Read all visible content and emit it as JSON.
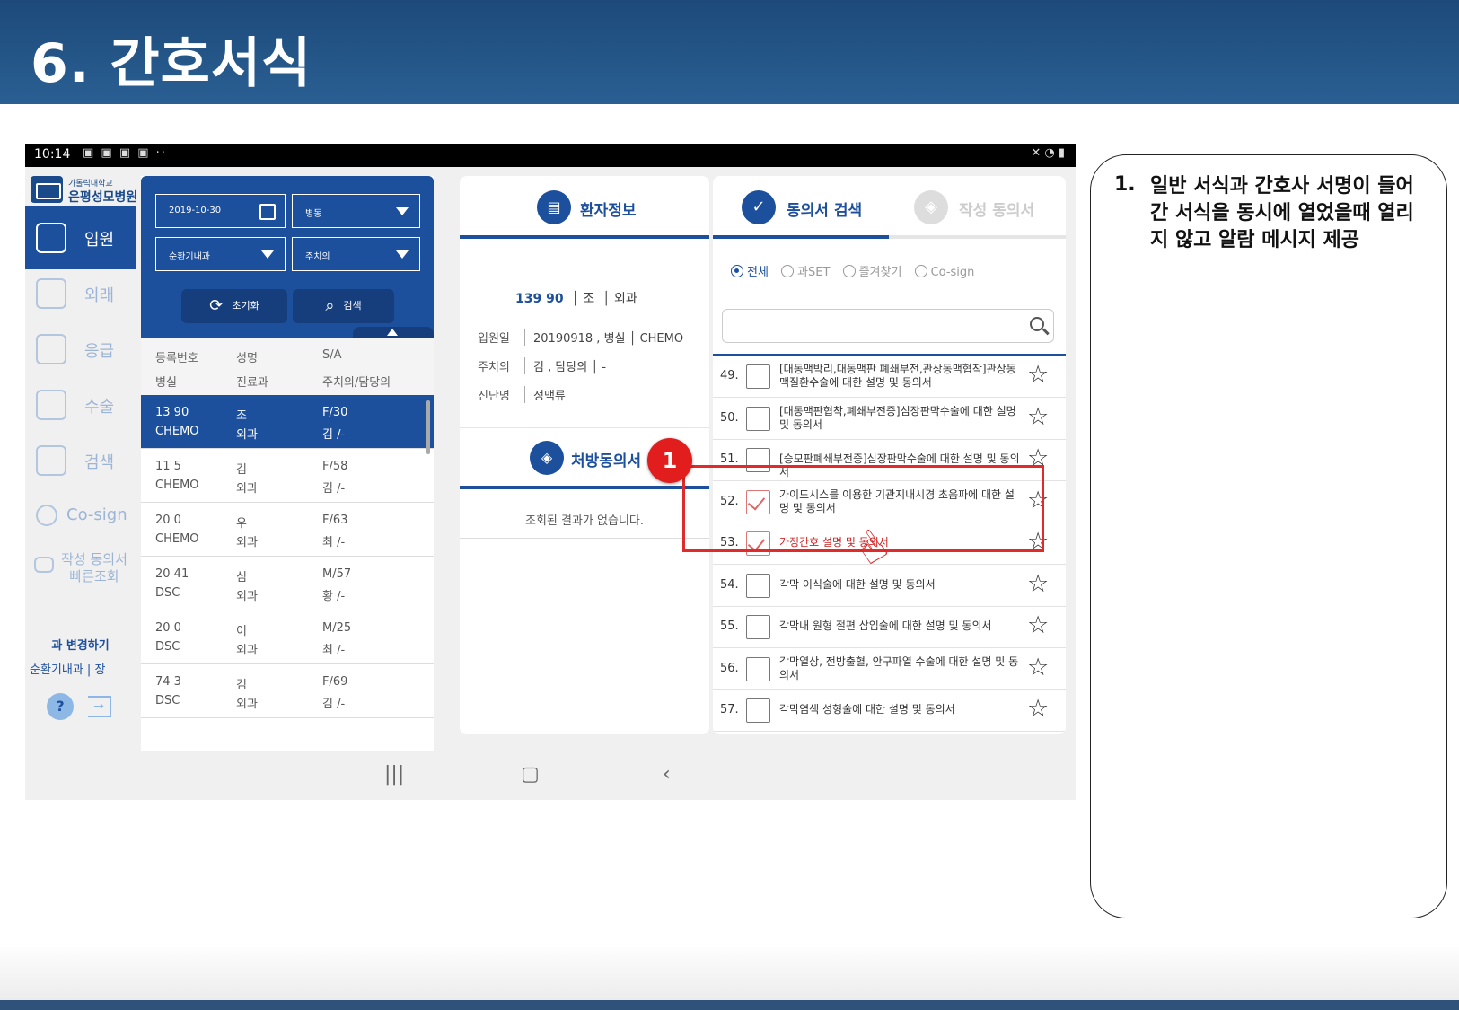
{
  "slide": {
    "title": "6. 간호서식",
    "callout": {
      "number": "1.",
      "text": "일반 서식과 간호사 서명이 들어간 서식을 동시에 열었을때 열리지 않고 알람 메시지 제공"
    },
    "badge": "1"
  },
  "status_bar": {
    "time": "10:14",
    "icons": "▣ ▣ ▣ ▣ ··",
    "right": "✕ ◔ ▮"
  },
  "nav": {
    "logo_sub": "가톨릭대학교",
    "logo_name": "은평성모병원",
    "items": [
      {
        "label": "입원",
        "active": true
      },
      {
        "label": "외래"
      },
      {
        "label": "응급"
      },
      {
        "label": "수술"
      },
      {
        "label": "검색"
      },
      {
        "label": "Co-sign"
      },
      {
        "label": "작성 동의서 빠른조회"
      }
    ],
    "change_label": "과 변경하기",
    "dept_label": "순환기내과 |  장",
    "help": "?",
    "logout": "→"
  },
  "filter": {
    "date": "2019-10-30",
    "ward": "병동",
    "dept": "순환기내과",
    "doctor": "주치의",
    "reset": "초기화",
    "search": "검색"
  },
  "list_header": {
    "reg_no": "등록번호",
    "name": "성명",
    "sa": "S/A",
    "room": "병실",
    "dept": "진료과",
    "doctor": "주치의/담당의"
  },
  "patients": [
    {
      "id": "13  90",
      "room": "CHEMO",
      "name": "조",
      "dept": "외과",
      "sa": "F/30",
      "doc": "김    /-",
      "selected": true
    },
    {
      "id": "11   5",
      "room": "CHEMO",
      "name": "김",
      "dept": "외과",
      "sa": "F/58",
      "doc": "김    /-"
    },
    {
      "id": "20   0",
      "room": "CHEMO",
      "name": "우",
      "dept": "외과",
      "sa": "F/63",
      "doc": "최    /-"
    },
    {
      "id": "20  41",
      "room": "DSC",
      "name": "심",
      "dept": "외과",
      "sa": "M/57",
      "doc": "황    /-"
    },
    {
      "id": "20   0",
      "room": "DSC",
      "name": "이",
      "dept": "외과",
      "sa": "M/25",
      "doc": "최    /-"
    },
    {
      "id": "74  3",
      "room": "DSC",
      "name": "김",
      "dept": "외과",
      "sa": "F/69",
      "doc": "김    /-"
    }
  ],
  "patient_info": {
    "header": "환자정보",
    "id": "139  90",
    "name": "조",
    "dept": "외과",
    "admit_label": "입원일",
    "admit_value": "20190918 , 병실  │  CHEMO",
    "doctor_label": "주치의",
    "doctor_value": "김    , 담당의  │  -",
    "diag_label": "진단명",
    "diag_value": "정맥류"
  },
  "prescription": {
    "header": "처방동의서",
    "empty": "조회된 결과가 없습니다."
  },
  "consent": {
    "tab_search": "동의서 검색",
    "tab_written": "작성 동의서",
    "filters": [
      "전체",
      "과SET",
      "즐겨찾기",
      "Co-sign"
    ],
    "search_placeholder": "",
    "items": [
      {
        "no": "49.",
        "text": "[대동맥박리,대동맥판 폐쇄부전,관상동맥협착]관상동맥질환수술에 대한 설명 및 동의서",
        "checked": false
      },
      {
        "no": "50.",
        "text": "[대동맥판협착,폐쇄부전증]심장판막수술에 대한 설명 및 동의서",
        "checked": false
      },
      {
        "no": "51.",
        "text": "[승모판폐쇄부전증]심장판막수술에 대한 설명 및 동의서",
        "checked": false
      },
      {
        "no": "52.",
        "text": "가이드시스를 이용한 기관지내시경 초음파에 대한 설명 및 동의서",
        "checked": true
      },
      {
        "no": "53.",
        "text": "가정간호 설명 및 동의서",
        "checked": true,
        "highlight": true
      },
      {
        "no": "54.",
        "text": "각막 이식술에 대한 설명 및 동의서",
        "checked": false
      },
      {
        "no": "55.",
        "text": "각막내 원형 절편 삽입술에 대한 설명 및 동의서",
        "checked": false
      },
      {
        "no": "56.",
        "text": "각막열상, 전방출혈, 안구파열 수술에 대한 설명 및 동의서",
        "checked": false
      },
      {
        "no": "57.",
        "text": "각막염색 성형술에 대한 설명 및 동의서",
        "checked": false
      }
    ]
  },
  "android_nav": {
    "recents": "|||",
    "home": "▢",
    "back": "‹"
  },
  "colors": {
    "primary": "#1c4f9c",
    "header": "#1d4a7a",
    "alert": "#e11d1d"
  }
}
